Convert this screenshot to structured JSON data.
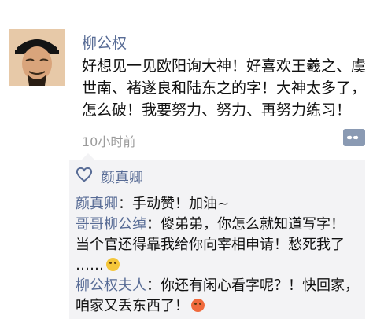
{
  "post": {
    "poster_name": "柳公权",
    "text_lines": [
      "好想见一见欧阳询大神！好喜欢王羲之、虞",
      "世南、褚遂良和陆东之的字！大神太多了，",
      "怎么破！我要努力、努力、再努力练习！"
    ],
    "timestamp": "10小时前"
  },
  "likes": {
    "names": "颜真卿"
  },
  "comments": [
    {
      "name": "颜真卿",
      "text": "：手动赞！加油~"
    },
    {
      "name": "哥哥柳公绰",
      "text": "：傻弟弟，你怎么就知道写字！",
      "cont1": "当个官还得靠我给你向宰相申请！愁死我了",
      "cont2": "……"
    },
    {
      "name": "柳公权夫人",
      "text": "：你还有闲心看字呢？！快回家，",
      "cont1": "咱家又丢东西了！"
    }
  ],
  "icons": {
    "avatar": "avatar-portrait",
    "comment": "comment-more-icon",
    "like": "heart-icon",
    "emoji1": "sweat-smile-emoji-icon",
    "emoji2": "angry-face-emoji-icon"
  },
  "colors": {
    "name_blue": "#576b95",
    "panel_bg": "#f3f3f5",
    "timestamp_gray": "#9b9b9b"
  }
}
